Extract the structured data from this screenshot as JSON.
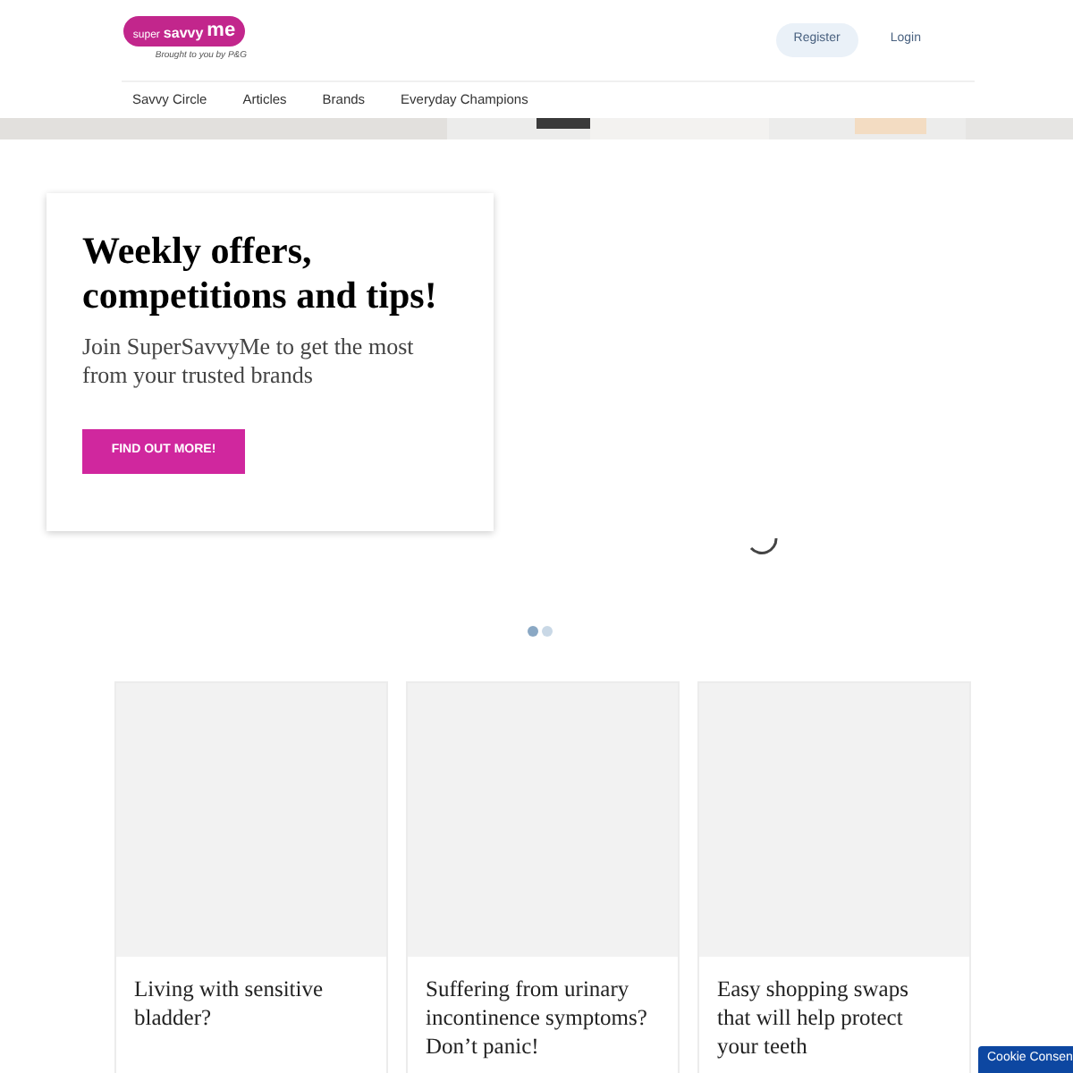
{
  "logo": {
    "wordmark_small": "super",
    "wordmark_mid": "savvy",
    "wordmark_big": "me",
    "tagline": "Brought to you by P&G"
  },
  "header_buttons": [
    {
      "label": "Register",
      "kind": "pill"
    },
    {
      "label": "Login",
      "kind": "link"
    }
  ],
  "nav": [
    "Savvy Circle",
    "Articles",
    "Brands",
    "Everyday Champions"
  ],
  "hero_card": {
    "title": "Weekly offers, competitions and tips!",
    "text": "Join SuperSavvyMe to get the most from your trusted brands",
    "button": "FIND OUT MORE!"
  },
  "carousel_dots": [
    {
      "selected": true
    },
    {
      "selected": false
    }
  ],
  "articles": [
    {
      "title": "Living with sensitive bladder?"
    },
    {
      "title": "Suffering from urinary incontinence symptoms? Don’t panic!"
    },
    {
      "title": "Easy shopping swaps that will help protect your teeth"
    }
  ],
  "cookie_button": "Cookie Consen"
}
